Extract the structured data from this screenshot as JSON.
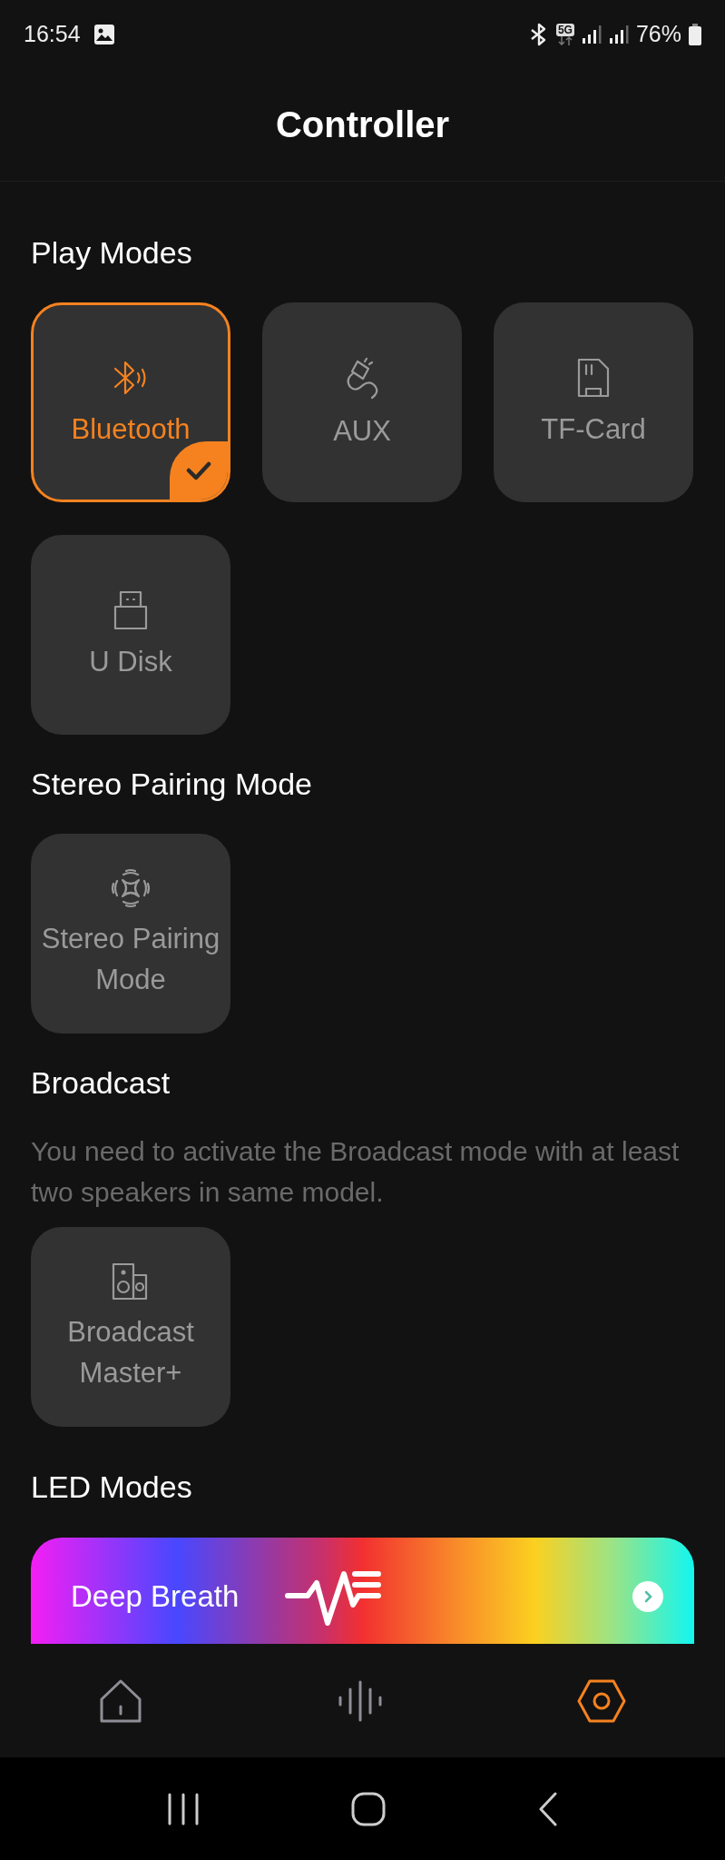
{
  "status_bar": {
    "time": "16:54",
    "network": "5G",
    "battery": "76%"
  },
  "header": {
    "title": "Controller"
  },
  "sections": [
    {
      "title": "Play Modes",
      "tiles": [
        {
          "label": "Bluetooth",
          "selected": true
        },
        {
          "label": "AUX",
          "selected": false
        },
        {
          "label": "TF-Card",
          "selected": false
        },
        {
          "label": "U Disk",
          "selected": false
        }
      ]
    },
    {
      "title": "Stereo Pairing Mode",
      "tiles": [
        {
          "label": "Stereo Pairing Mode",
          "selected": false
        }
      ]
    },
    {
      "title": "Broadcast",
      "description": "You need to activate the Broadcast mode with at least two speakers in same model.",
      "tiles": [
        {
          "label": "Broadcast Master+",
          "selected": false
        }
      ]
    },
    {
      "title": "LED Modes",
      "led_mode": {
        "label": "Deep Breath"
      }
    }
  ],
  "bottom_nav": [
    {
      "selected": false
    },
    {
      "selected": false
    },
    {
      "selected": true
    }
  ]
}
